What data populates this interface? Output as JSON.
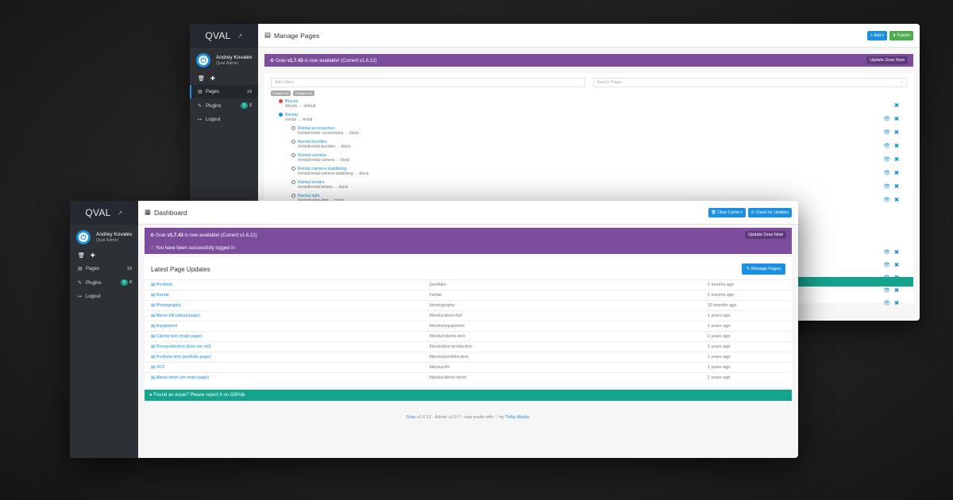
{
  "back": {
    "brand": "QVAL",
    "user": {
      "name": "Andrey Kovalev",
      "role": "Qval Admin"
    },
    "nav": [
      {
        "label": "Pages",
        "count": "19"
      },
      {
        "label": "Plugins",
        "badge": "6",
        "count": "8"
      },
      {
        "label": "Logout"
      }
    ],
    "title": "Manage Pages",
    "add_label": "Add",
    "publish_label": "Publish",
    "notice": {
      "prefix": "Grav ",
      "version": "v1.7.43",
      "suffix": " is now available! (Current v1.6.12)",
      "button": "Update Grav Now"
    },
    "filter_placeholder": "Add Filters",
    "search_placeholder": "Search Pages",
    "chips": [
      "Expand All",
      "Collapse All"
    ],
    "pages": [
      {
        "title": "Blocks",
        "route": "/blocks",
        "tpl": "default"
      },
      {
        "title": "Rental",
        "route": "/rental",
        "tpl": "rental"
      },
      {
        "title": "Rental accessories",
        "route": "/rental/rental- accessories",
        "tpl": "block"
      },
      {
        "title": "Rental bundles",
        "route": "/rental/rental-bundles",
        "tpl": "block"
      },
      {
        "title": "Rental camera",
        "route": "/rental/rental-camera",
        "tpl": "block"
      },
      {
        "title": "Rental camera stabilizing",
        "route": "/rental/rental-camera-stabilizing",
        "tpl": "block"
      },
      {
        "title": "Rental lenses",
        "route": "/rental/rental-lenses",
        "tpl": "block"
      },
      {
        "title": "Rental light",
        "route": "/rental/rental-light",
        "tpl": "block"
      }
    ]
  },
  "front": {
    "brand": "QVAL",
    "user": {
      "name": "Andrey Kovalev",
      "role": "Qval Admin"
    },
    "nav": [
      {
        "label": "Pages",
        "count": "19"
      },
      {
        "label": "Plugins",
        "badge": "6",
        "count": "8"
      },
      {
        "label": "Logout"
      }
    ],
    "title": "Dashboard",
    "clear_cache": "Clear Cache",
    "check_updates": "Check for Updates",
    "notice": {
      "prefix": "Grav ",
      "version": "v1.7.43",
      "suffix": " is now available! (Current v1.6.12)",
      "button": "Update Grav Now",
      "logged_in": "You have been successfully logged in"
    },
    "updates_title": "Latest Page Updates",
    "manage_pages": "Manage Pages",
    "rows": [
      {
        "title": "Portfolio",
        "route": "/portfolio",
        "when": "2 months ago"
      },
      {
        "title": "Rental",
        "route": "/rental",
        "when": "2 months ago"
      },
      {
        "title": "Photography",
        "route": "/photography",
        "when": "10 months ago"
      },
      {
        "title": "About full (about page)",
        "route": "/blocks/about-full",
        "when": "1 years ago"
      },
      {
        "title": "Equipment",
        "route": "/blocks/equipment",
        "when": "1 years ago"
      },
      {
        "title": "Clients text (main page)",
        "route": "/blocks/clients-text",
        "when": "1 years ago"
      },
      {
        "title": "Pre-production (how we roll)",
        "route": "/blocks/pre-production",
        "when": "1 years ago"
      },
      {
        "title": "Portfolio text (portfolio page)",
        "route": "/blocks/portfolio-text",
        "when": "1 years ago"
      },
      {
        "title": "VFX",
        "route": "/blocks/vfx",
        "when": "1 years ago"
      },
      {
        "title": "About short (on main page)",
        "route": "/blocks/about-short",
        "when": "1 years ago"
      }
    ],
    "issue_text": "Found an issue? Please report it on GitHub.",
    "credits": {
      "grav": "Grav",
      "mid": " v1.6.12 - Admin v1.9.7 - was made with ",
      "by": " by ",
      "trilby": "Trilby Media",
      "end": "."
    }
  },
  "colors": {
    "accent": "#1b8fe0",
    "notice": "#7b4d9c",
    "teal": "#12a48c",
    "sidebar": "#2d3035"
  },
  "icons": [
    "external-link-icon",
    "power-icon",
    "trash-icon",
    "plus-icon",
    "file-icon",
    "plug-icon",
    "logout-icon",
    "eye-icon",
    "close-icon",
    "grid-icon",
    "refresh-icon",
    "github-icon",
    "heart-icon"
  ]
}
